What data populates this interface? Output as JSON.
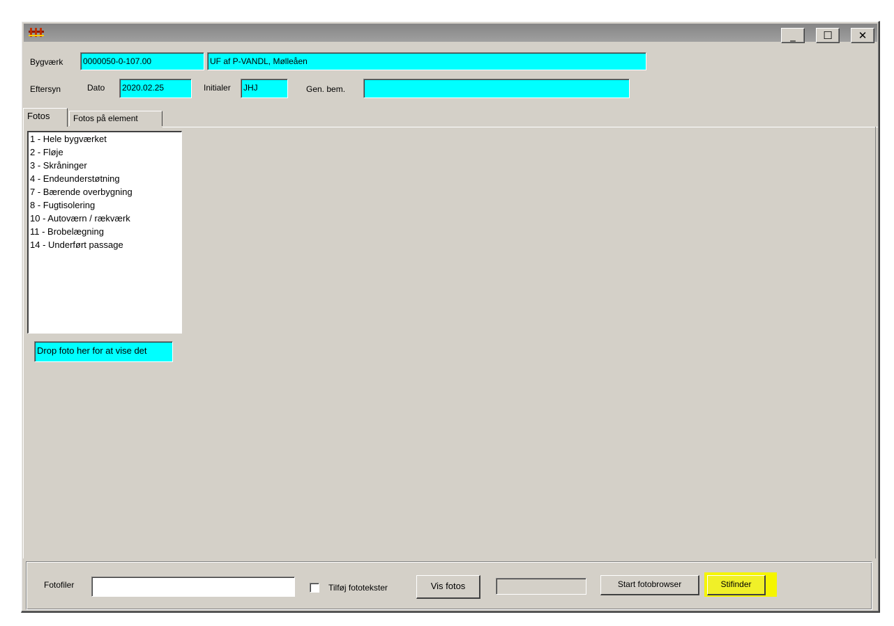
{
  "window": {
    "icon": "bridge-icon",
    "controls": {
      "minimize": "_",
      "maximize": "☐",
      "close": "✕"
    }
  },
  "header": {
    "bygvaerk_label": "Bygværk",
    "bygvaerk_number": "0000050-0-107.00",
    "bygvaerk_name": "UF af P-VANDL, Mølleåen",
    "eftersyn_label": "Eftersyn",
    "dato_label": "Dato",
    "dato_value": "2020.02.25",
    "initialer_label": "Initialer",
    "initialer_value": "JHJ",
    "genbem_label": "Gen. bem.",
    "genbem_value": ""
  },
  "tabs": [
    {
      "label": "Fotos",
      "active": true
    },
    {
      "label": "Fotos på element",
      "active": false
    }
  ],
  "element_list": [
    "1 - Hele bygværket",
    "2 - Fløje",
    "3 - Skråninger",
    "4 - Endeunderstøtning",
    "7 - Bærende overbygning",
    "8 - Fugtisolering",
    "10 - Autoværn / rækværk",
    "11 - Brobelægning",
    "14 - Underført passage"
  ],
  "drop_zone": "Drop foto her for at vise det",
  "footer": {
    "fotofiler_label": "Fotofiler",
    "fotofiler_value": "",
    "checkbox_label": "Tilføj fototekster",
    "checkbox_checked": false,
    "vis_fotos": "Vis fotos",
    "start_fotobrowser": "Start fotobrowser",
    "stifinder": "Stifinder"
  },
  "colors": {
    "field_cyan": "#00ffff",
    "highlight_yellow": "#f5f500",
    "face": "#d4d0c8"
  }
}
